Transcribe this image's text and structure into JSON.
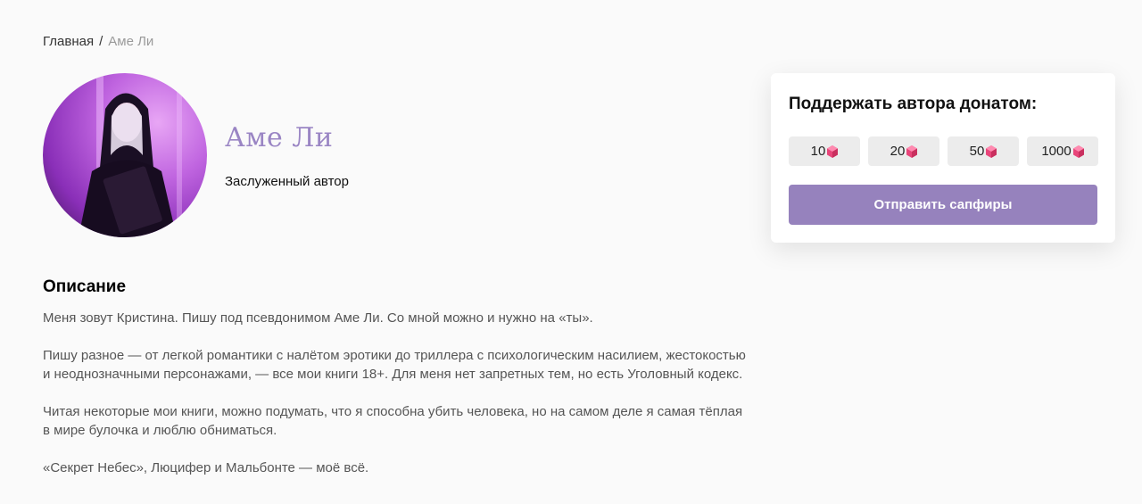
{
  "breadcrumb": {
    "home": "Главная",
    "separator": "/",
    "current": "Аме Ли"
  },
  "author": {
    "name": "Аме Ли",
    "status": "Заслуженный автор"
  },
  "description": {
    "title": "Описание",
    "paragraphs": [
      "Меня зовут Кристина. Пишу под псевдонимом Аме Ли. Со мной можно и нужно на «ты».",
      "Пишу разное — от легкой романтики с налётом эротики до триллера с психологическим насилием, жестокостью и неоднозначными персонажами, — все мои книги 18+. Для меня нет запретных тем, но есть Уголовный кодекс.",
      "Читая некоторые мои книги, можно подумать, что я способна убить человека, но на самом деле я самая тёплая в мире булочка и люблю обниматься.",
      "«Секрет Небес», Люцифер и Мальбонте — моё всё."
    ]
  },
  "donate": {
    "title": "Поддержать автора донатом:",
    "amounts": [
      "10",
      "20",
      "50",
      "1000"
    ],
    "currency_icon": "sapphire-gem-icon",
    "send_label": "Отправить сапфиры"
  },
  "colors": {
    "accent": "#9682bd",
    "name_color": "#9a85c4",
    "gem": "#e8457a"
  }
}
